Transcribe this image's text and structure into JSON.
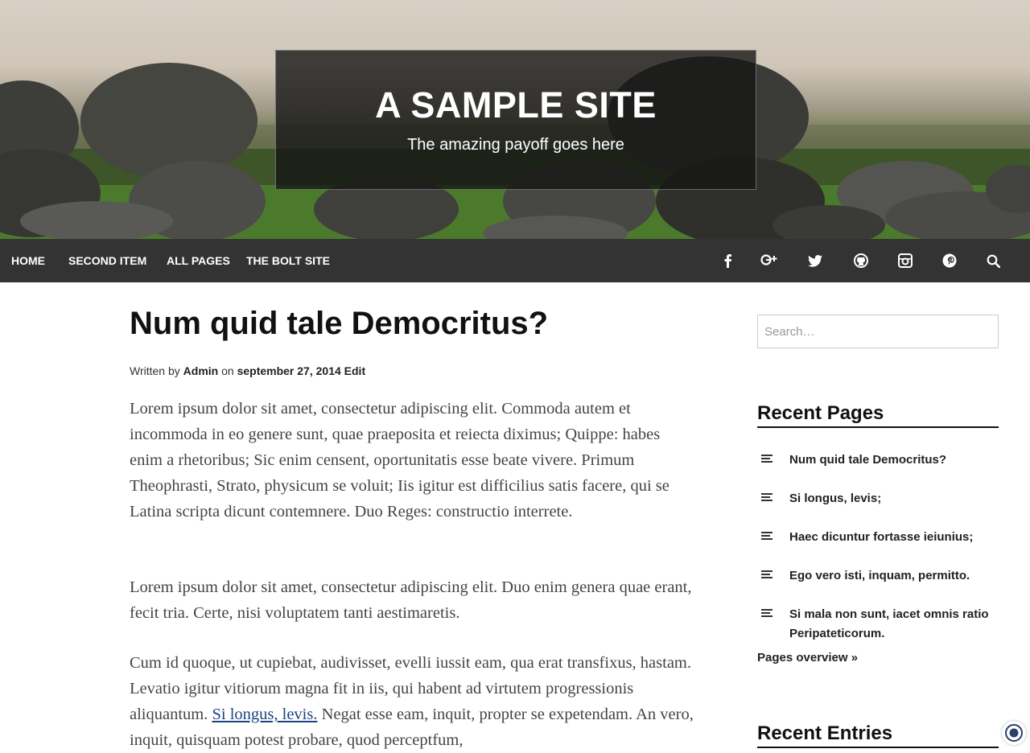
{
  "header": {
    "site_title": "A SAMPLE SITE",
    "payoff": "The amazing payoff goes here"
  },
  "nav": {
    "items": [
      {
        "label": "HOME"
      },
      {
        "label": "SECOND ITEM"
      },
      {
        "label": "ALL PAGES"
      },
      {
        "label": "THE BOLT SITE"
      }
    ],
    "social_icons": [
      "facebook-icon",
      "google-plus-icon",
      "twitter-icon",
      "github-icon",
      "instagram-icon",
      "pinterest-icon",
      "search-icon"
    ]
  },
  "post": {
    "title": "Num quid tale Democritus?",
    "meta": {
      "written_by": "Written by",
      "author": "Admin",
      "on": "on",
      "date": "september 27, 2014",
      "edit": "Edit"
    },
    "p1": "Lorem ipsum dolor sit amet, consectetur adipiscing elit. Commoda autem et incommoda in eo genere sunt, quae praeposita et reiecta diximus; Quippe: habes enim a rhetoribus; Sic enim censent, oportunitatis esse beate vivere. Primum Theophrasti, Strato, physicum se voluit; Iis igitur est difficilius satis facere, qui se Latina scripta dicunt contemnere. Duo Reges: constructio interrete.",
    "p2": "Lorem ipsum dolor sit amet, consectetur adipiscing elit. Duo enim genera quae erant, fecit tria. Certe, nisi voluptatem tanti aestimaretis.",
    "p3_before": "Cum id quoque, ut cupiebat, audivisset, evelli iussit eam, qua erat transfixus, hastam. Levatio igitur vitiorum magna fit in iis, qui habent ad virtutem progressionis aliquantum. ",
    "p3_link": "Si longus, levis.",
    "p3_after": " Negat esse eam, inquit, propter se expetendam. An vero, inquit, quisquam potest probare, quod perceptfum,"
  },
  "sidebar": {
    "search_placeholder": "Search…",
    "recent_pages_title": "Recent Pages",
    "recent_pages": [
      {
        "label": "Num quid tale Democritus?"
      },
      {
        "label": "Si longus, levis;"
      },
      {
        "label": "Haec dicuntur fortasse ieiunius;"
      },
      {
        "label": "Ego vero isti, inquam, permitto."
      },
      {
        "label": "Si mala non sunt, iacet omnis ratio Peripateticorum."
      }
    ],
    "pages_overview": "Pages overview »",
    "recent_entries_title": "Recent Entries"
  },
  "colors": {
    "navbar": "#333333",
    "link": "#1a4480"
  }
}
